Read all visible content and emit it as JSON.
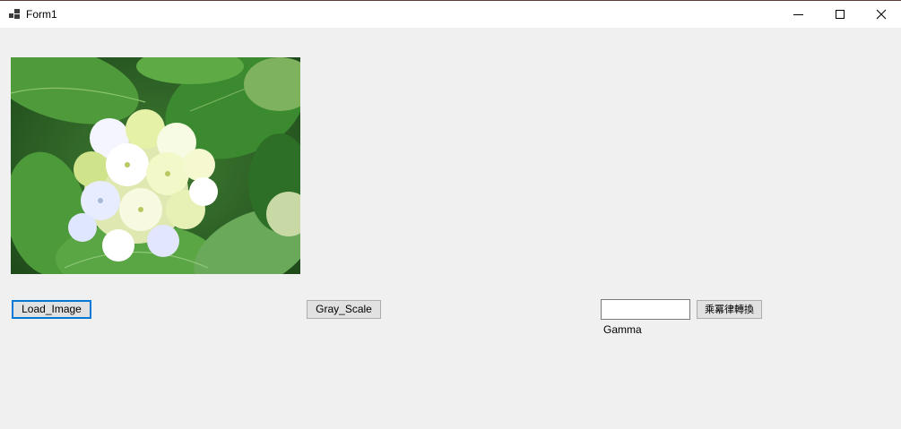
{
  "window": {
    "title": "Form1"
  },
  "title_icons": {
    "app": "app-form-icon",
    "minimize": "minimize-icon",
    "maximize": "maximize-icon",
    "close": "close-icon"
  },
  "image": {
    "description": "photo of white and pale-yellow hydrangea flowers among green leaves"
  },
  "buttons": {
    "load": "Load_Image",
    "gray": "Gray_Scale",
    "power": "乘冪律轉換"
  },
  "gamma": {
    "value": "",
    "label": "Gamma"
  }
}
